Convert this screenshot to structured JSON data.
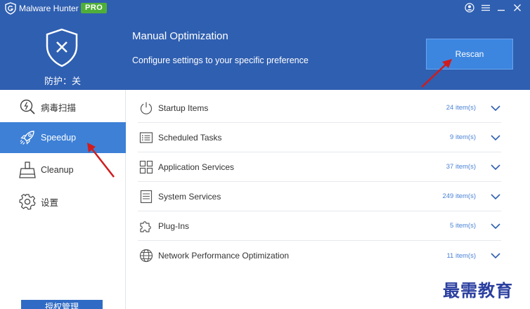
{
  "app": {
    "title": "Malware Hunter",
    "badge": "PRO",
    "icons": {
      "logo": "shield-g-icon",
      "account": "account-icon",
      "menu": "menu-icon",
      "minimize": "minimize-icon",
      "close": "close-icon"
    }
  },
  "header": {
    "protection_status": "防护：关",
    "page_title": "Manual Optimization",
    "page_subtitle": "Configure settings to your specific preference",
    "rescan_label": "Rescan",
    "colors": {
      "header_bg": "#2f5fb1",
      "button_bg": "#3c86e0"
    }
  },
  "sidebar": {
    "items": [
      {
        "label": "病毒扫描",
        "icon": "virus-scan-icon",
        "active": false
      },
      {
        "label": "Speedup",
        "icon": "rocket-icon",
        "active": true
      },
      {
        "label": "Cleanup",
        "icon": "broom-icon",
        "active": false
      },
      {
        "label": "设置",
        "icon": "gear-icon",
        "active": false
      }
    ],
    "auth_button": "授权管理"
  },
  "rows": [
    {
      "label": "Startup Items",
      "count": "24 item(s)",
      "icon": "power-icon"
    },
    {
      "label": "Scheduled Tasks",
      "count": "9 item(s)",
      "icon": "task-list-icon"
    },
    {
      "label": "Application Services",
      "count": "37 item(s)",
      "icon": "app-grid-icon"
    },
    {
      "label": "System Services",
      "count": "249 item(s)",
      "icon": "system-doc-icon"
    },
    {
      "label": "Plug-Ins",
      "count": "5 item(s)",
      "icon": "puzzle-icon"
    },
    {
      "label": "Network Performance Optimization",
      "count": "11 item(s)",
      "icon": "globe-icon"
    }
  ],
  "watermark": "最需教育"
}
